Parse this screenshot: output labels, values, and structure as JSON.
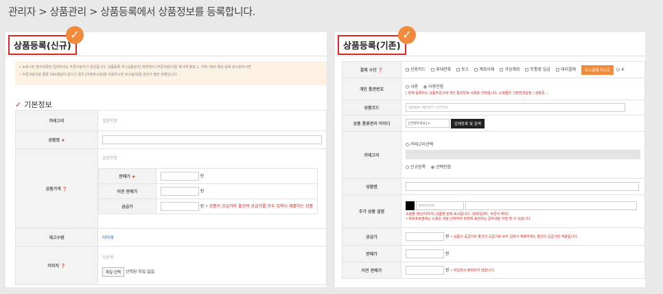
{
  "breadcrumb": "관리자 > 상품관리 > 상품등록에서 상품정보를 등록합니다.",
  "new_panel": {
    "title": "상품등록(신규)",
    "notice_line1": "• ★표시된 필수항목만 입력하셔도 주문서링크가 생성됩니다. 상품등록 후 [상품관리] 화면에서 [주문서링크]를 복사해 블로그, 카페, SNS 채널 등에 포스팅하시면",
    "notice_line2": "• 주문서링크를 통할 SNS채널이 없으신 경우 [마켓포스팅]를 이용하시면 포스팅/댓글 관리가 훨씬 편해집니다.",
    "section_title": "기본정보",
    "rows": {
      "category_label": "카테고리",
      "category_value": "설정안함",
      "name_label": "상품명",
      "price_label": "상품가격",
      "price_note": "설정안함",
      "sale_label": "판매가",
      "prev_label": "이전 판매가",
      "supply_label": "공급가",
      "unit": "원",
      "supply_note": "• 상품의 공급가와 출선의 공급가를 모두 입력시 재출하는 상품",
      "stock_label": "재고수량",
      "stock_value": "미미제",
      "image_label": "이미지",
      "image_note": "미등록",
      "file_button": "파일 선택",
      "file_status": "선택된 파일 없음"
    }
  },
  "old_panel": {
    "title": "상품등록(기존)",
    "pay_label": "결제 수단",
    "pay_options": [
      "신용카드",
      "휴대전화",
      "토스",
      "계좌이체",
      "가상계좌",
      "무통장 입금",
      "데리결제"
    ],
    "pay_button": "토스결제 리스트",
    "pay_more": "4",
    "consent_label": "개인 통관번호",
    "consent_opt1": "사용",
    "consent_opt2": "사용안함",
    "consent_note": "( 현재 등록하는 상품주문시에 개인 통관번호 사용을 선택합니다. 쇼핑몰은 기본환경설정 ) 설정중 ...",
    "code_label": "상품코드",
    "code_value": "X6084~N0587~X7724",
    "mgmt_label": "상품 통류관리 아이디",
    "mgmt_select": "[선택하세요]",
    "mgmt_button": "업체등록 및 검색",
    "category_label": "카테고리",
    "category_opt": "카테고리선택",
    "reg_opt1": "신규등록",
    "reg_opt2": "선택안함",
    "name_label": "상품명",
    "desc_label": "추가 상품 설명",
    "color_value": "#000000",
    "desc_note1": "쇼핑몰 메인(이미지) 상품명 밑에 표시됩니다. (모바일/PC, 주문서 제외)",
    "desc_note2": "• 파워포토찜에는 노출은 색을 선택하여 화면에 표현되는 글자색을 지정 할 수 있습니다.",
    "supply_label": "공급가",
    "supply_note": "• 상품의 공급가와 출선의 공급가를 모두 입력시 재출하게는 출선의 공급가만 적용됩니다.",
    "sale_label": "판매가",
    "prev_label": "이전 판매가",
    "prev_note": "• 미입력시 출력되지 않습니다.",
    "unit": "원"
  },
  "colors": {
    "accent_red": "#e0231b",
    "check_orange": "#f08b3c",
    "notice_bg": "#fdf1e2"
  }
}
